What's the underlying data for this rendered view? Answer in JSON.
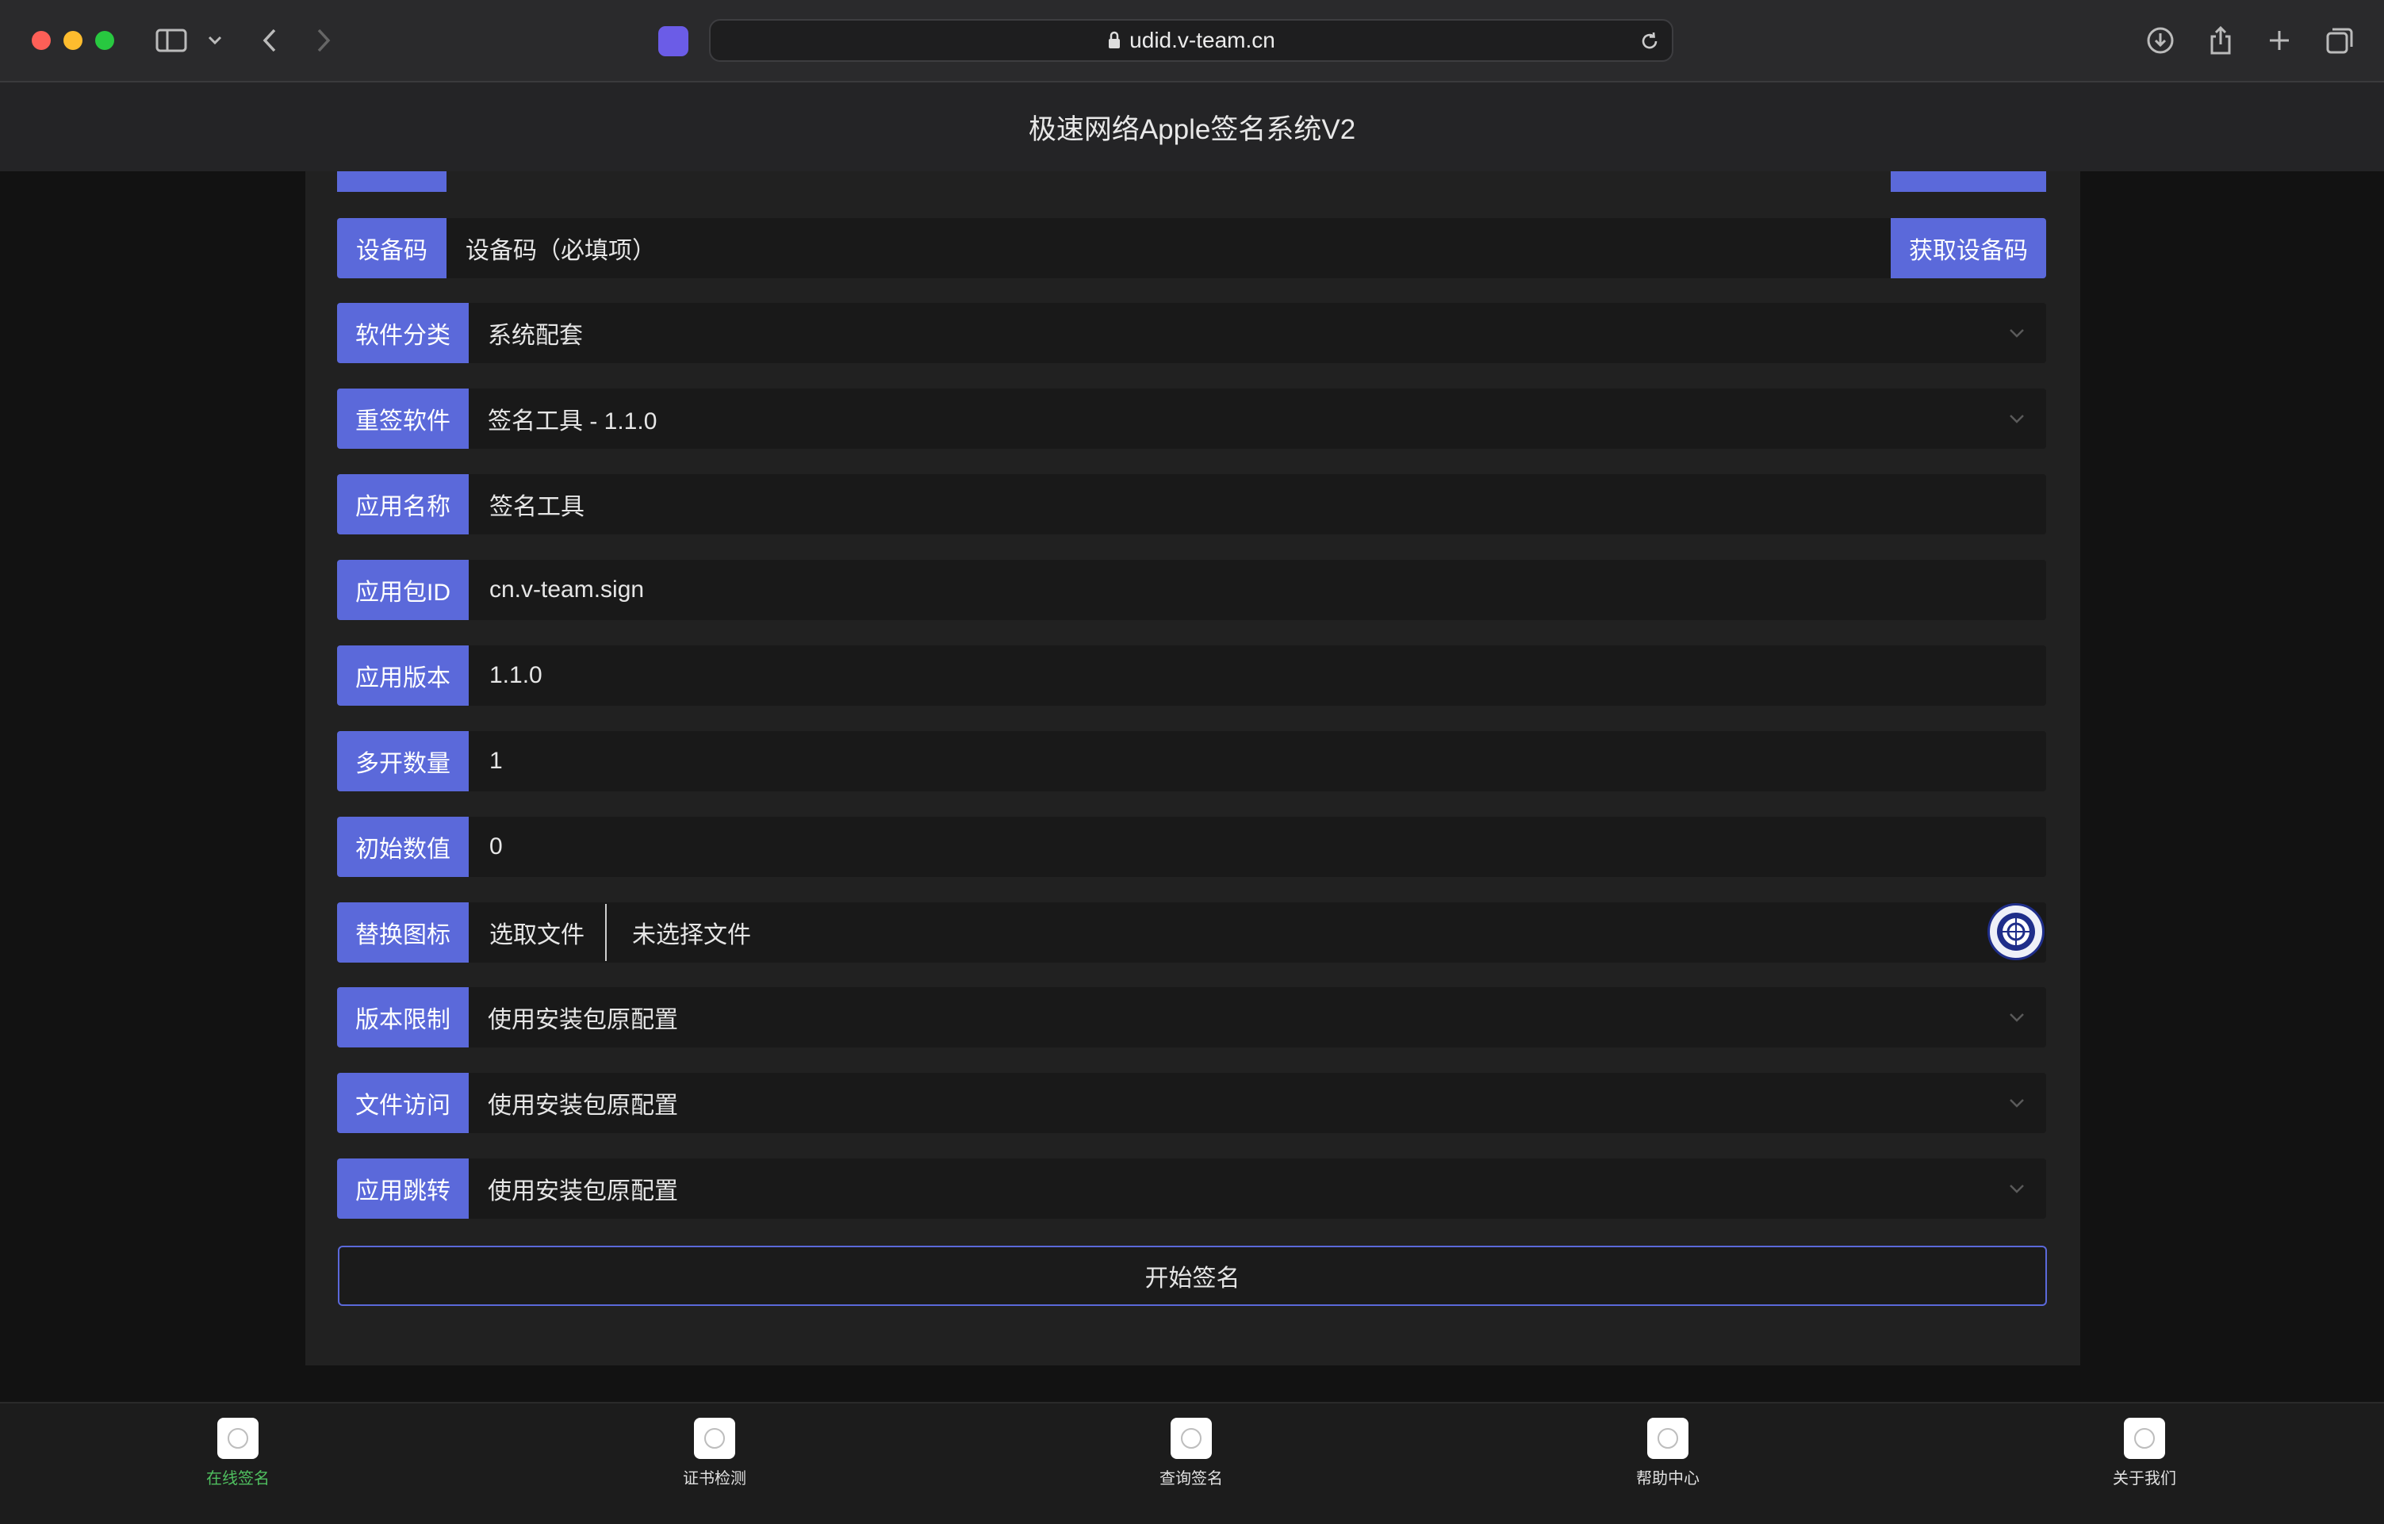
{
  "browser": {
    "url": "udid.v-team.cn"
  },
  "page": {
    "title": "极速网络Apple签名系统V2"
  },
  "form": {
    "device_code": {
      "label": "设备码",
      "placeholder": "设备码（必填项）",
      "button": "获取设备码"
    },
    "category": {
      "label": "软件分类",
      "value": "系统配套"
    },
    "software": {
      "label": "重签软件",
      "value": "签名工具 - 1.1.0"
    },
    "app_name": {
      "label": "应用名称",
      "value": "签名工具"
    },
    "bundle_id": {
      "label": "应用包ID",
      "value": "cn.v-team.sign"
    },
    "app_version": {
      "label": "应用版本",
      "value": "1.1.0"
    },
    "multi_count": {
      "label": "多开数量",
      "value": "1"
    },
    "initial_value": {
      "label": "初始数值",
      "value": "0"
    },
    "icon": {
      "label": "替换图标",
      "choose": "选取文件",
      "no_file": "未选择文件"
    },
    "version_limit": {
      "label": "版本限制",
      "value": "使用安装包原配置"
    },
    "file_access": {
      "label": "文件访问",
      "value": "使用安装包原配置"
    },
    "app_jump": {
      "label": "应用跳转",
      "value": "使用安装包原配置"
    },
    "submit": "开始签名"
  },
  "tabs": [
    {
      "label": "在线签名",
      "active": true
    },
    {
      "label": "证书检测"
    },
    {
      "label": "查询签名"
    },
    {
      "label": "帮助中心"
    },
    {
      "label": "关于我们"
    }
  ],
  "colors": {
    "accent": "#5b69da",
    "active_tab": "#4fbf5f"
  }
}
